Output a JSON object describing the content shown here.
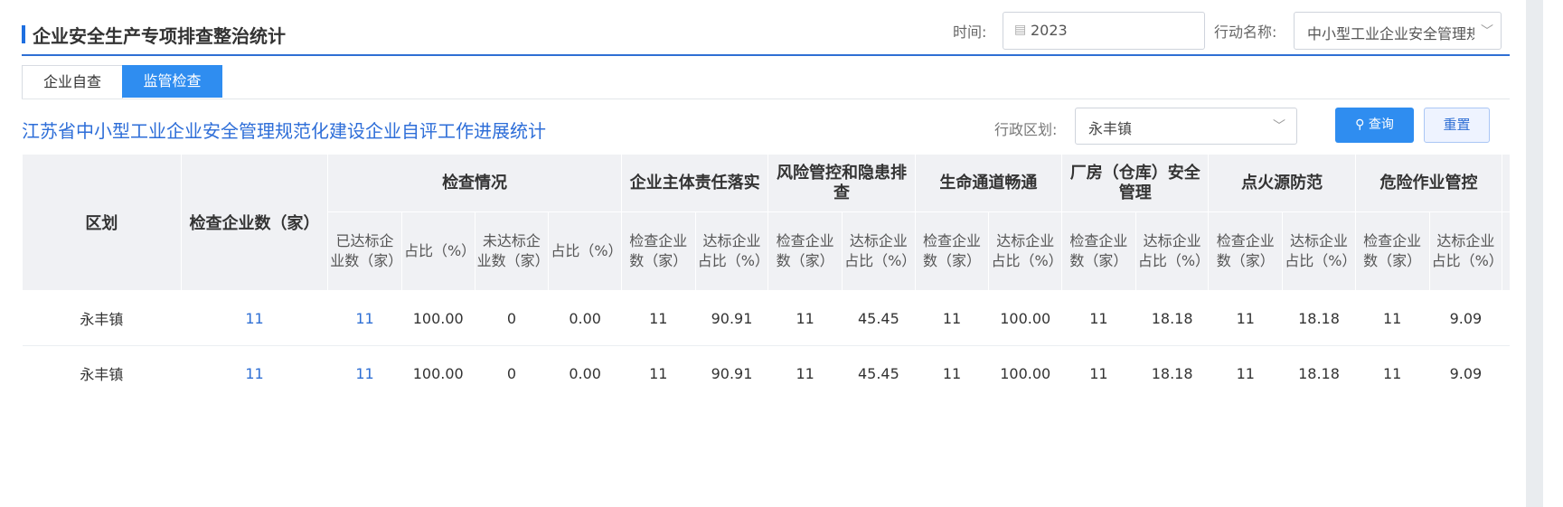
{
  "header": {
    "title": "企业安全生产专项排查整治统计",
    "time_label": "时间:",
    "time_value": "2023",
    "action_label": "行动名称:",
    "action_value": "中小型工业企业安全管理规范化建设"
  },
  "tabs": [
    {
      "label": "企业自查",
      "active": false
    },
    {
      "label": "监管检查",
      "active": true
    }
  ],
  "subbar": {
    "title": "江苏省中小型工业企业安全管理规范化建设企业自评工作进展统计",
    "region_label": "行政区划:",
    "region_value": "永丰镇",
    "query_label": "查询",
    "reset_label": "重置"
  },
  "table": {
    "col_district": "区划",
    "col_count": "检查企业数（家）",
    "groups": [
      "检查情况",
      "企业主体责任落实",
      "风险管控和隐患排查",
      "生命通道畅通",
      "厂房（仓库）安全管理",
      "点火源防范",
      "危险作业管控"
    ],
    "sub_headers": [
      "已达标企业数（家）",
      "占比（%）",
      "未达标企业数（家）",
      "占比（%）",
      "检查企业数（家）",
      "达标企业占比（%）",
      "检查企业数（家）",
      "达标企业占比（%）",
      "检查企业数（家）",
      "达标企业占比（%）",
      "检查企业数（家）",
      "达标企业占比（%）",
      "检查企业数（家）",
      "达标企业占比（%）",
      "检查企业数（家）",
      "达标企业占比（%）",
      "检"
    ],
    "rows": [
      [
        "永丰镇",
        "11",
        "11",
        "100.00",
        "0",
        "0.00",
        "11",
        "90.91",
        "11",
        "45.45",
        "11",
        "100.00",
        "11",
        "18.18",
        "11",
        "18.18",
        "11",
        "9.09",
        ""
      ],
      [
        "永丰镇",
        "11",
        "11",
        "100.00",
        "0",
        "0.00",
        "11",
        "90.91",
        "11",
        "45.45",
        "11",
        "100.00",
        "11",
        "18.18",
        "11",
        "18.18",
        "11",
        "9.09",
        ""
      ]
    ]
  },
  "colors": {
    "accent": "#2f8df0",
    "link": "#2f6fd4",
    "header_bg": "#f0f1f4",
    "title_bar": "#1e6fe0"
  }
}
